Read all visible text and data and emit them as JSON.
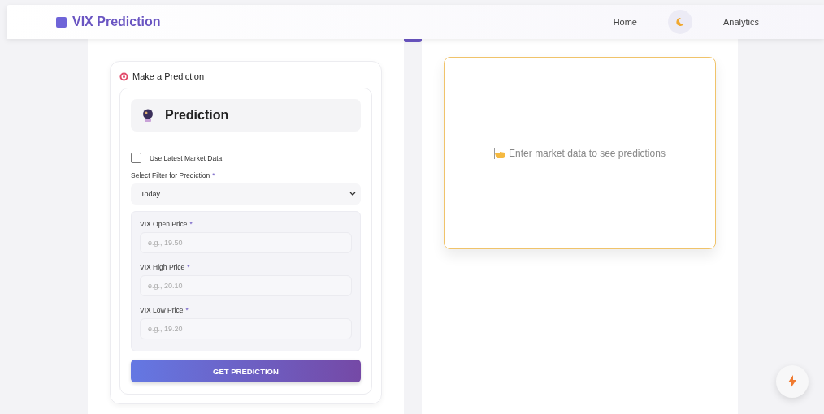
{
  "header": {
    "brand": "VIX Prediction",
    "nav": [
      {
        "label": "Home",
        "kind": "link"
      },
      {
        "kind": "theme-toggle"
      },
      {
        "label": "Analytics",
        "kind": "link"
      }
    ]
  },
  "form_card": {
    "title": "Make a Prediction",
    "heading": "Prediction",
    "checkbox": {
      "label": "Use Latest Market Data",
      "checked": false
    },
    "filter": {
      "label": "Select Filter for Prediction",
      "required_mark": "*",
      "value": "Today"
    },
    "fields": [
      {
        "label": "VIX Open Price",
        "required_mark": "*",
        "placeholder": "e.g., 19.50"
      },
      {
        "label": "VIX High Price",
        "required_mark": "*",
        "placeholder": "e.g., 20.10"
      },
      {
        "label": "VIX Low Price",
        "required_mark": "*",
        "placeholder": "e.g., 19.20"
      }
    ],
    "button": "GET PREDICTION"
  },
  "result_card": {
    "message": "Enter market data to see predictions"
  }
}
